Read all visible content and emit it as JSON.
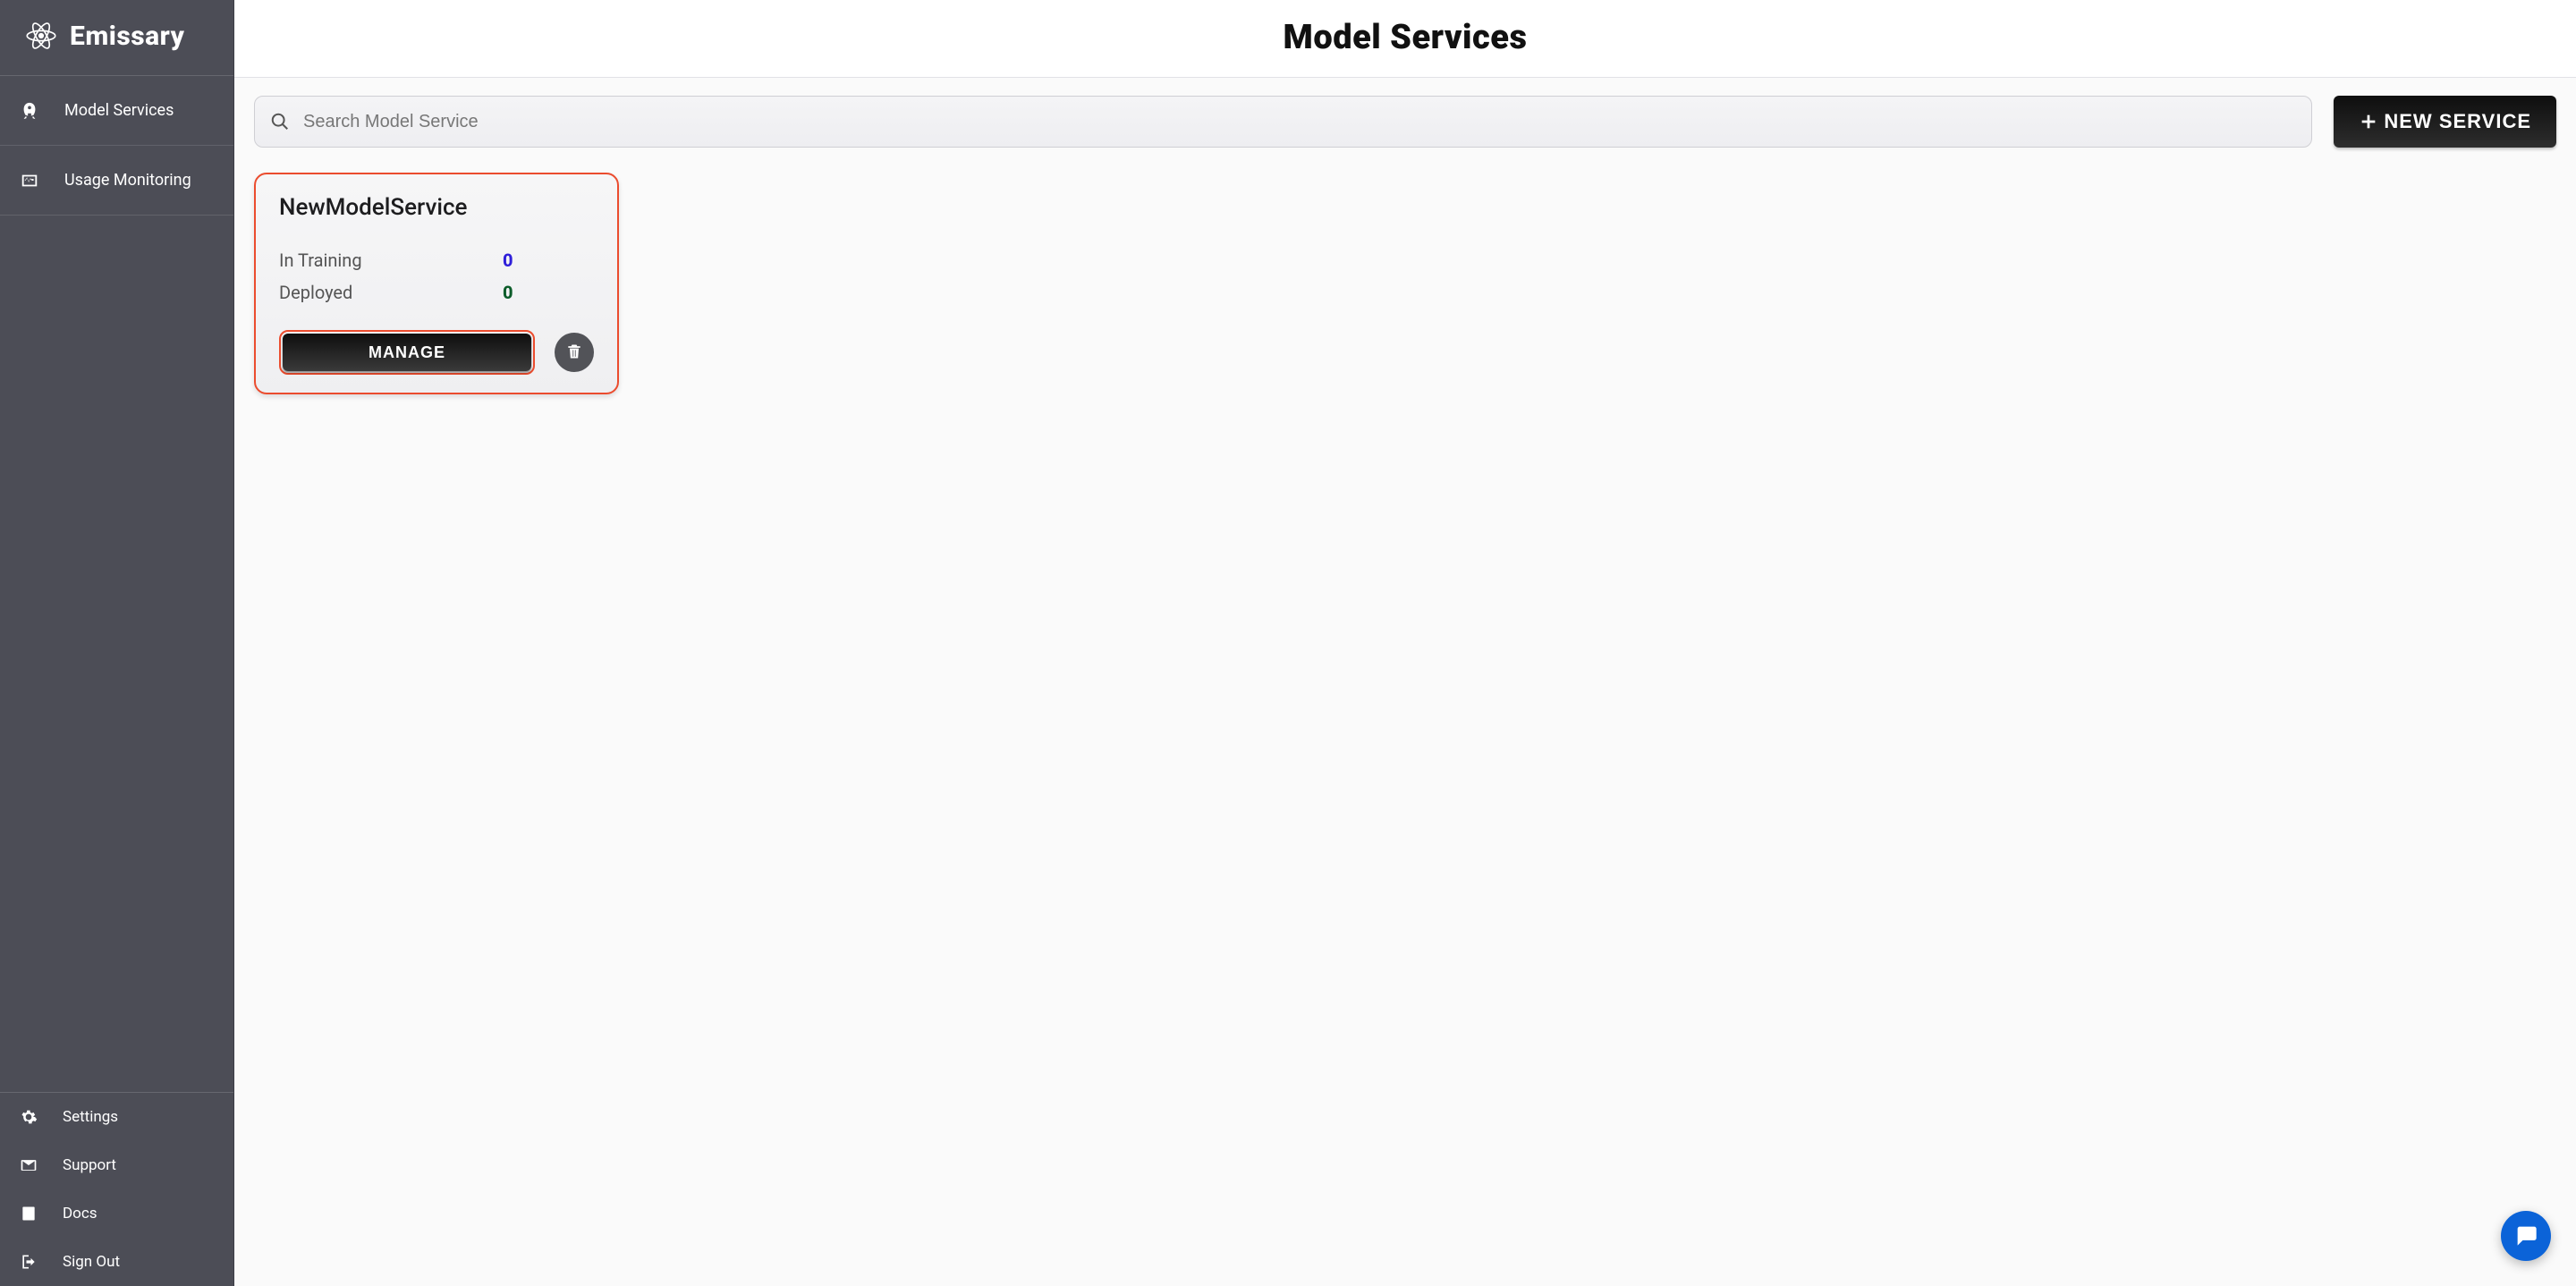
{
  "brand": {
    "name": "Emissary"
  },
  "sidebar": {
    "nav": [
      {
        "label": "Model Services"
      },
      {
        "label": "Usage Monitoring"
      }
    ],
    "footer": [
      {
        "label": "Settings"
      },
      {
        "label": "Support"
      },
      {
        "label": "Docs"
      },
      {
        "label": "Sign Out"
      }
    ]
  },
  "header": {
    "title": "Model Services"
  },
  "toolbar": {
    "search_placeholder": "Search Model Service",
    "new_service_label": "NEW SERVICE"
  },
  "services": [
    {
      "name": "NewModelService",
      "stats": {
        "in_training_label": "In Training",
        "in_training_value": "0",
        "deployed_label": "Deployed",
        "deployed_value": "0"
      },
      "manage_label": "MANAGE"
    }
  ],
  "colors": {
    "accent_orange": "#eb4c2e",
    "training_value": "#2f1fd9",
    "deployed_value": "#0c5c2a"
  }
}
